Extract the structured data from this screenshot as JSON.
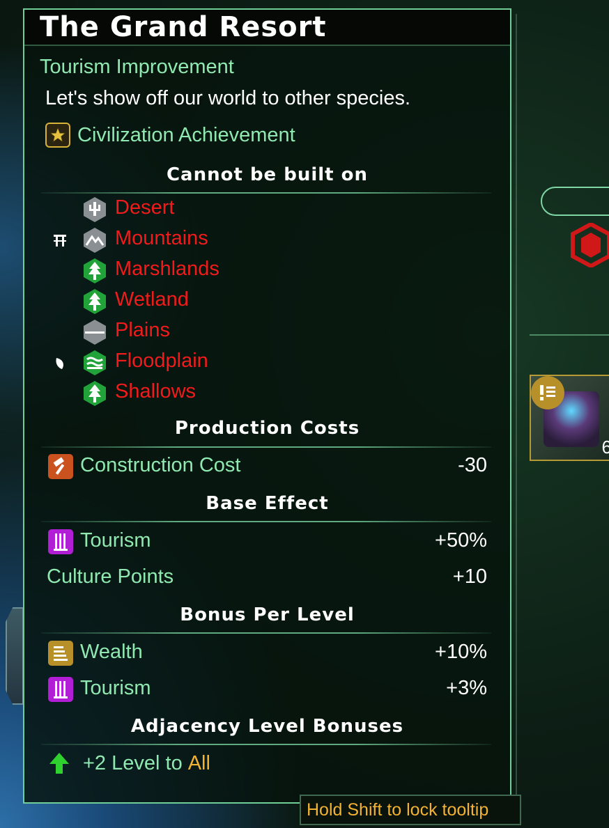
{
  "tooltip": {
    "title": "The Grand Resort",
    "type": "Tourism Improvement",
    "description": "Let's show off our world to other species.",
    "achievement_label": "Civilization Achievement",
    "cannot_build_header": "Cannot be built on",
    "terrains": [
      {
        "label": "Desert",
        "icon": "desert-icon"
      },
      {
        "label": "Mountains",
        "icon": "mountains-icon"
      },
      {
        "label": "Marshlands",
        "icon": "forest-icon"
      },
      {
        "label": "Wetland",
        "icon": "forest-icon"
      },
      {
        "label": "Plains",
        "icon": "plains-icon"
      },
      {
        "label": "Floodplain",
        "icon": "floodplain-icon"
      },
      {
        "label": "Shallows",
        "icon": "forest-icon"
      }
    ],
    "production_header": "Production Costs",
    "construction_cost": {
      "label": "Construction Cost",
      "value": "-30"
    },
    "base_effect_header": "Base Effect",
    "base_effects": [
      {
        "label": "Tourism",
        "value": "+50%",
        "icon": "tourism-icon"
      },
      {
        "label": "Culture Points",
        "value": "+10",
        "icon": ""
      }
    ],
    "bonus_header": "Bonus Per Level",
    "bonuses": [
      {
        "label": "Wealth",
        "value": "+10%",
        "icon": "wealth-icon"
      },
      {
        "label": "Tourism",
        "value": "+3%",
        "icon": "tourism-icon"
      }
    ],
    "adjacency_header": "Adjacency Level Bonuses",
    "adjacency_text": "+2 Level to",
    "adjacency_target": "All"
  },
  "hint": "Hold Shift to lock tooltip",
  "side": {
    "project_count": "6"
  },
  "colors": {
    "panel_border": "#6fcf97",
    "label_green": "#8fe9b0",
    "forbidden_red": "#f21b1b",
    "gold": "#f2b233"
  }
}
